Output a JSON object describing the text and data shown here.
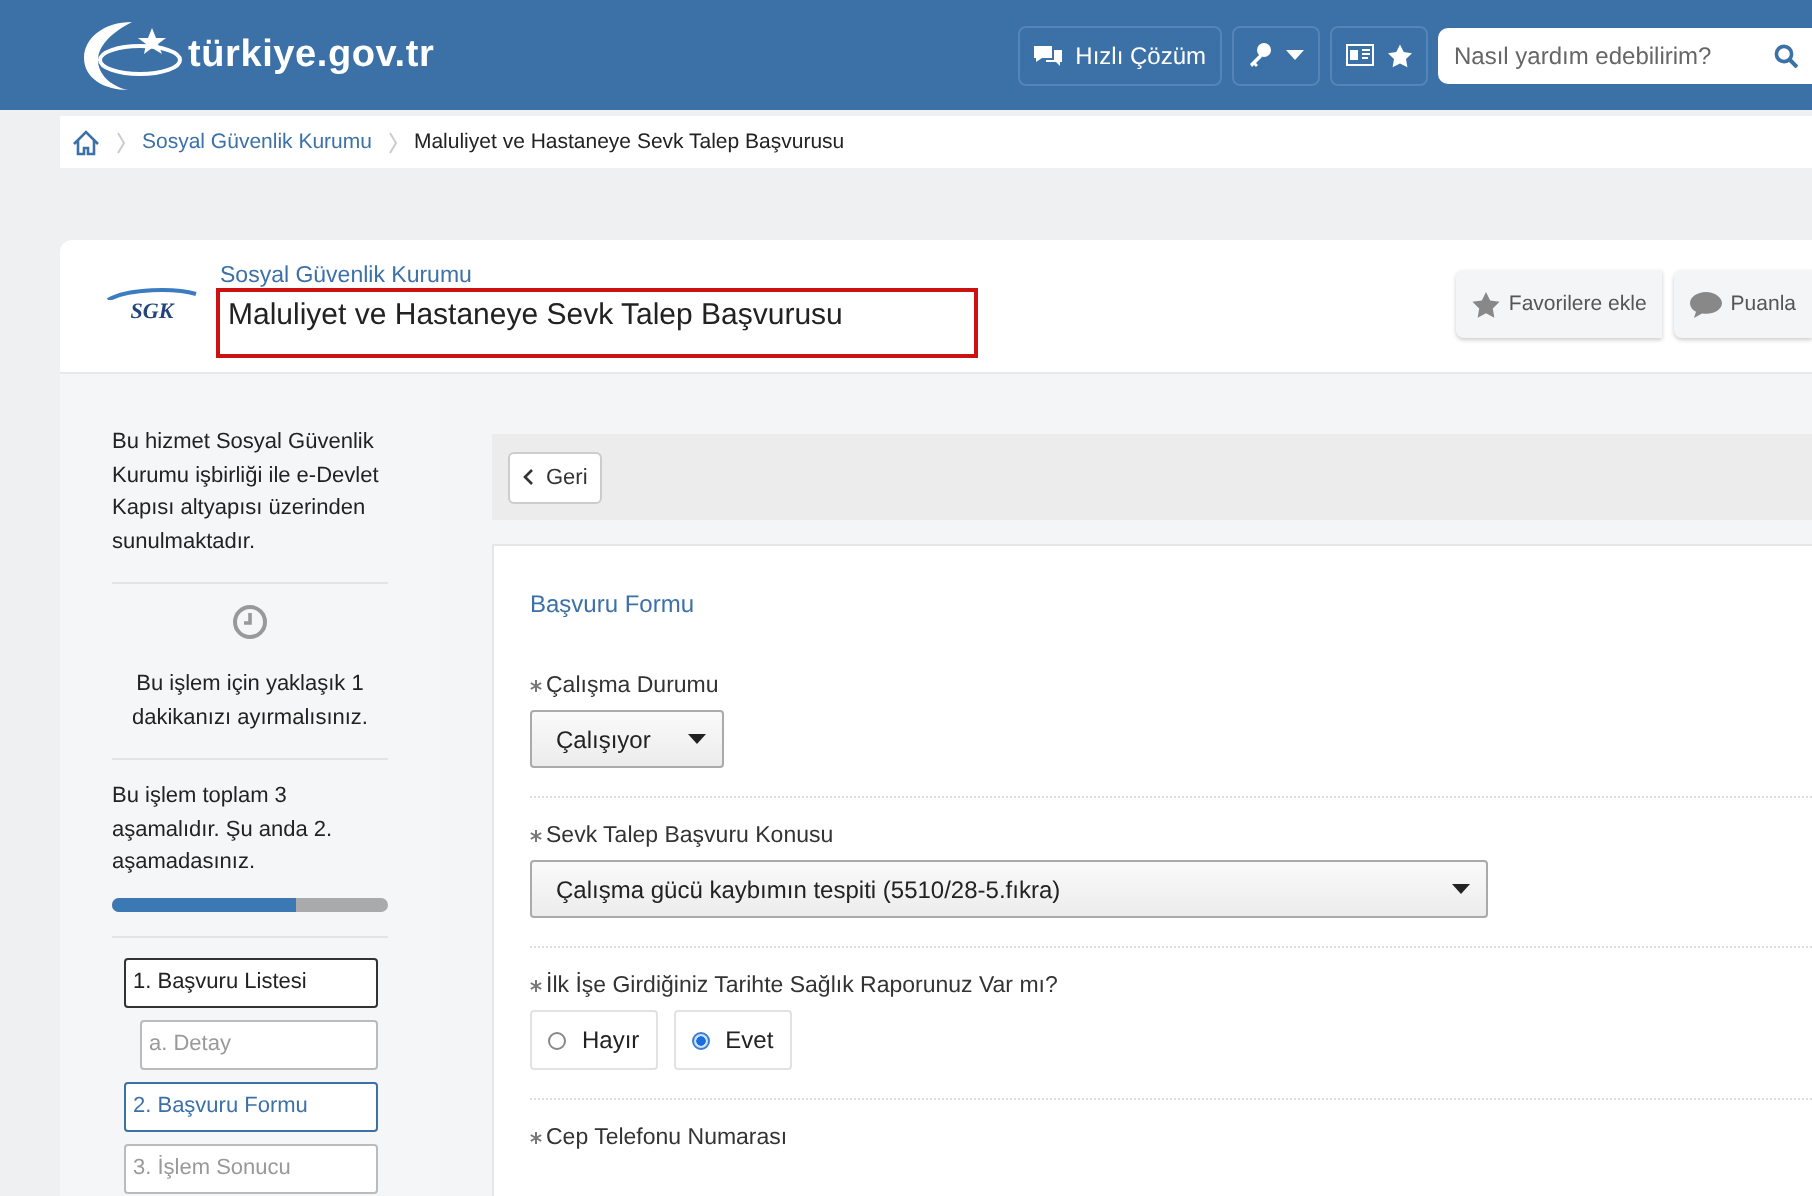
{
  "header": {
    "logo_text": "türkiye.gov.tr",
    "quick_button": "Hızlı Çözüm",
    "search": {
      "placeholder": "Nasıl yardım edebilirim?"
    }
  },
  "breadcrumb": [
    "Sosyal Güvenlik Kurumu",
    "Maluliyet ve Hastaneye Sevk Talep Başvurusu"
  ],
  "service": {
    "logo_text": "SGK",
    "agency": "Sosyal Güvenlik Kurumu",
    "title": "Maluliyet ve Hastaneye Sevk Talep Başvurusu",
    "highlighted": true,
    "actions": [
      {
        "kind": "favorite",
        "label": "Favorilere ekle"
      },
      {
        "kind": "rate",
        "label": "Puanla"
      }
    ]
  },
  "sidebar": {
    "info": "Bu hizmet Sosyal Güvenlik Kurumu işbirliği ile e-Devlet Kapısı altyapısı üzerinden sunulmaktadır.",
    "duration": "Bu işlem için yaklaşık 1 dakikanızı ayırmalısınız.",
    "progress_text": "Bu işlem toplam 3 aşamalıdır. Şu anda 2. aşamadasınız.",
    "level": 0.67,
    "steps": [
      {
        "label": "1. Başvuru Listesi",
        "completed": true,
        "selected": false,
        "children": [
          {
            "label": "a. Detay",
            "completed": false,
            "selected": false
          }
        ]
      },
      {
        "label": "2. Başvuru Formu",
        "completed": false,
        "selected": true
      },
      {
        "label": "3. İşlem Sonucu",
        "completed": false,
        "selected": false
      }
    ]
  },
  "back_button": "Geri",
  "form": {
    "title": "Başvuru Formu",
    "fields": [
      {
        "kind": "select",
        "label": "Çalışma Durumu",
        "required": true,
        "value": "Çalışıyor",
        "wide": false
      },
      {
        "kind": "select",
        "label": "Sevk Talep Başvuru Konusu",
        "required": true,
        "value": "Çalışma gücü kaybımın tespiti (5510/28-5.fıkra)",
        "wide": true
      },
      {
        "kind": "radio",
        "label": "İlk İşe Girdiğiniz Tarihte Sağlık Raporunuz Var mı?",
        "required": true,
        "options": [
          {
            "label": "Hayır",
            "selected": false
          },
          {
            "label": "Evet",
            "selected": true
          }
        ]
      },
      {
        "kind": "text",
        "label": "Cep Telefonu Numarası",
        "required": true
      }
    ]
  }
}
